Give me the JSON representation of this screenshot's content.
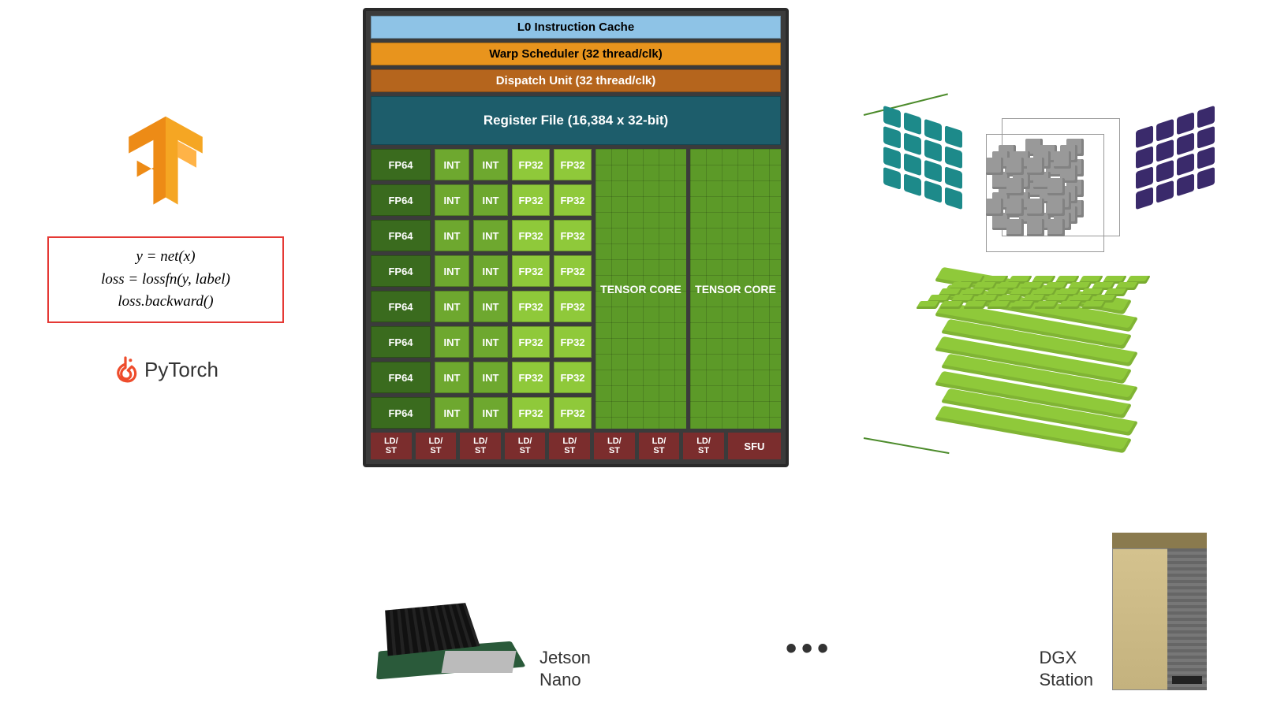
{
  "left": {
    "code_lines": [
      "y = net(x)",
      "loss = lossfn(y, label)",
      "loss.backward()"
    ],
    "frameworks": {
      "pytorch": "PyTorch"
    }
  },
  "sm": {
    "l0": "L0 Instruction Cache",
    "warp": "Warp Scheduler (32 thread/clk)",
    "dispatch": "Dispatch Unit (32 thread/clk)",
    "regfile": "Register File (16,384 x 32-bit)",
    "rows": 8,
    "fp64": "FP64",
    "int": "INT",
    "fp32": "FP32",
    "tensor": "TENSOR CORE",
    "ldst": "LD/\nST",
    "sfu": "SFU"
  },
  "hardware": {
    "jetson": "Jetson\nNano",
    "ellipsis": "•••",
    "dgx": "DGX\nStation"
  }
}
